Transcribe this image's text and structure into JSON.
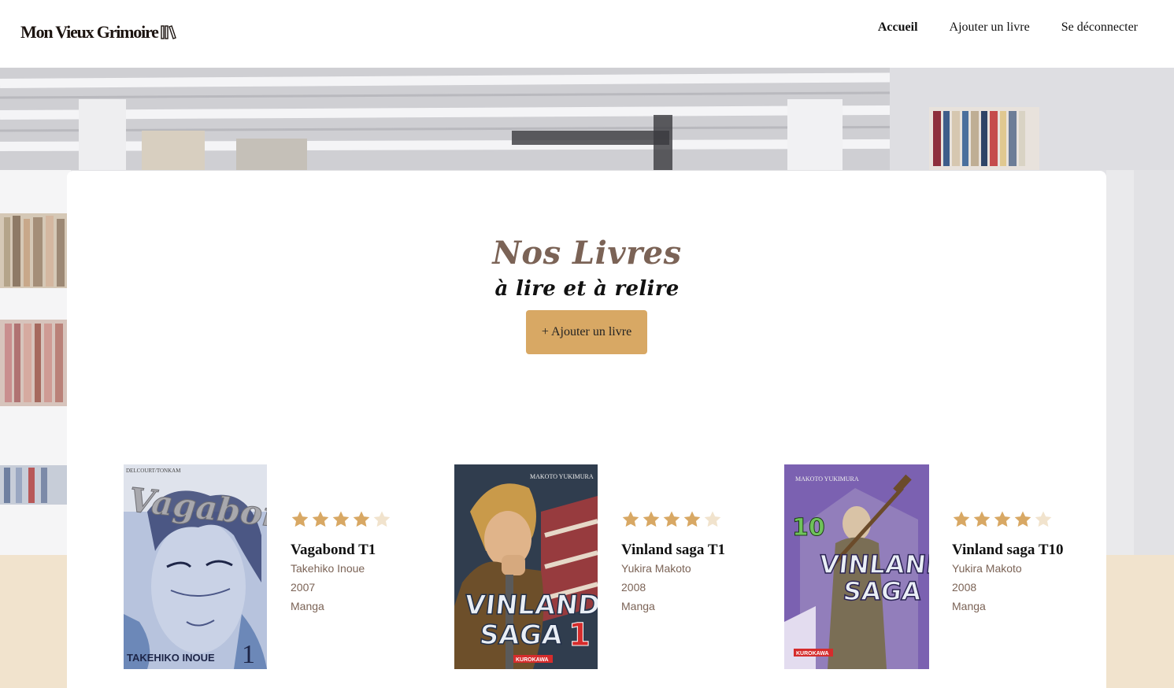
{
  "header": {
    "logo_text": "Mon Vieux Grimoire",
    "nav": [
      {
        "label": "Accueil",
        "active": true
      },
      {
        "label": "Ajouter un livre",
        "active": false
      },
      {
        "label": "Se déconnecter",
        "active": false
      }
    ]
  },
  "main": {
    "title": "Nos Livres",
    "subtitle": "à lire et à relire",
    "add_button": "+ Ajouter un livre"
  },
  "colors": {
    "accent": "#d8a864",
    "title_brown": "#7b6356",
    "star_filled": "#d8a864",
    "star_empty": "#f1e3cd",
    "beige_band": "#f1e3cd"
  },
  "books": [
    {
      "title": "Vagabond T1",
      "author": "Takehiko Inoue",
      "year": "2007",
      "genre": "Manga",
      "rating": 4,
      "rating_max": 5,
      "cover": {
        "top_text": "DELCOURT/TONKAM",
        "logo_text": "Vagabond",
        "author_text": "TAKEHIKO INOUE",
        "volume": "1"
      }
    },
    {
      "title": "Vinland saga T1",
      "author": "Yukira Makoto",
      "year": "2008",
      "genre": "Manga",
      "rating": 4,
      "rating_max": 5,
      "cover": {
        "top_text": "MAKOTO YUKIMURA",
        "logo_line1": "VINLAND",
        "logo_line2": "SAGA",
        "volume": "1",
        "publisher": "KUROKAWA"
      }
    },
    {
      "title": "Vinland saga T10",
      "author": "Yukira Makoto",
      "year": "2008",
      "genre": "Manga",
      "rating": 4,
      "rating_max": 5,
      "cover": {
        "top_text": "MAKOTO YUKIMURA",
        "logo_line1": "VINLAND",
        "logo_line2": "SAGA",
        "volume": "10",
        "publisher": "KUROKAWA"
      }
    }
  ]
}
